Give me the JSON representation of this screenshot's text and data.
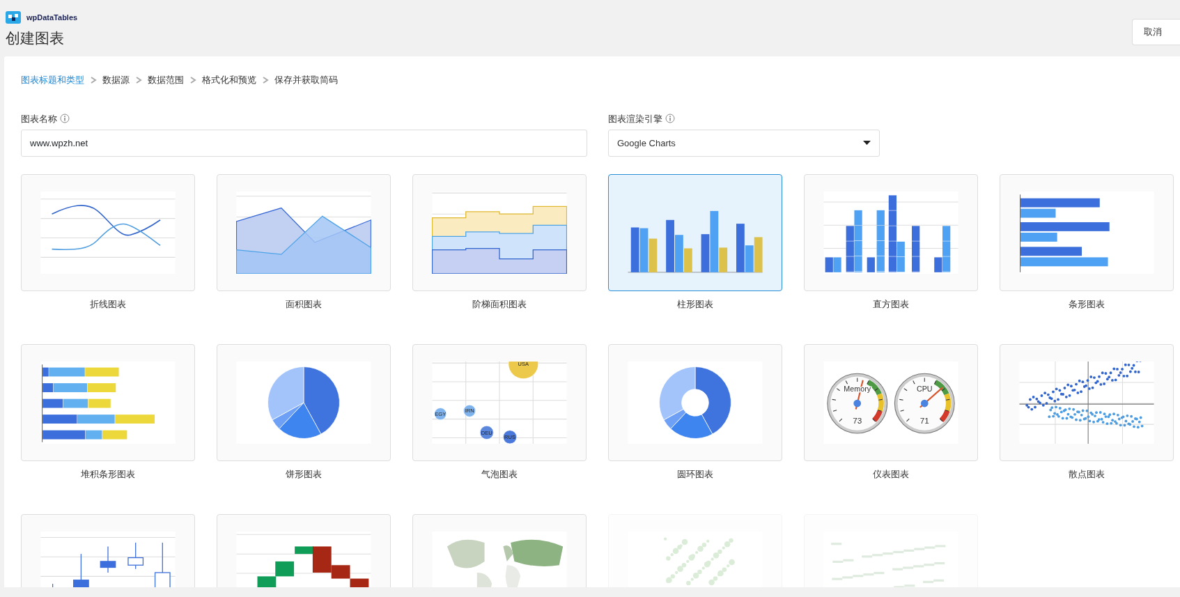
{
  "app": {
    "name": "wpDataTables"
  },
  "page_title": "创建图表",
  "cancel_button": "取消",
  "steps": [
    {
      "label": "图表标题和类型",
      "selected": true
    },
    {
      "label": "数据源",
      "selected": false
    },
    {
      "label": "数据范围",
      "selected": false
    },
    {
      "label": "格式化和预览",
      "selected": false
    },
    {
      "label": "保存并获取简码",
      "selected": false
    }
  ],
  "chart_name": {
    "label": "图表名称",
    "value": "www.wpzh.net"
  },
  "render_engine": {
    "label": "图表渲染引擎",
    "value": "Google Charts"
  },
  "chart_types": [
    {
      "kind": "line",
      "label": "折线图表",
      "selected": false,
      "disabled": false
    },
    {
      "kind": "area",
      "label": "面积图表",
      "selected": false,
      "disabled": false
    },
    {
      "kind": "stepped_area",
      "label": "阶梯面积图表",
      "selected": false,
      "disabled": false
    },
    {
      "kind": "column",
      "label": "柱形图表",
      "selected": true,
      "disabled": false
    },
    {
      "kind": "histogram",
      "label": "直方图表",
      "selected": false,
      "disabled": false
    },
    {
      "kind": "bar",
      "label": "条形图表",
      "selected": false,
      "disabled": false
    },
    {
      "kind": "stacked_bar",
      "label": "堆积条形图表",
      "selected": false,
      "disabled": false
    },
    {
      "kind": "pie",
      "label": "饼形图表",
      "selected": false,
      "disabled": false
    },
    {
      "kind": "bubble",
      "label": "气泡图表",
      "selected": false,
      "disabled": false,
      "bubbles": [
        "USA",
        "EGY",
        "IRN",
        "DEU",
        "RUS"
      ]
    },
    {
      "kind": "donut",
      "label": "圆环图表",
      "selected": false,
      "disabled": false
    },
    {
      "kind": "gauge",
      "label": "仪表图表",
      "selected": false,
      "disabled": false,
      "gauges": [
        {
          "name": "Memory",
          "value": "73"
        },
        {
          "name": "CPU",
          "value": "71"
        }
      ]
    },
    {
      "kind": "scatter",
      "label": "散点图表",
      "selected": false,
      "disabled": false
    },
    {
      "kind": "candlestick",
      "selected": false,
      "disabled": false
    },
    {
      "kind": "waterfall",
      "selected": false,
      "disabled": false
    },
    {
      "kind": "geo",
      "selected": false,
      "disabled": false
    },
    {
      "kind": "marker_map",
      "selected": false,
      "disabled": true
    },
    {
      "kind": "text_map",
      "selected": false,
      "disabled": true
    }
  ]
}
